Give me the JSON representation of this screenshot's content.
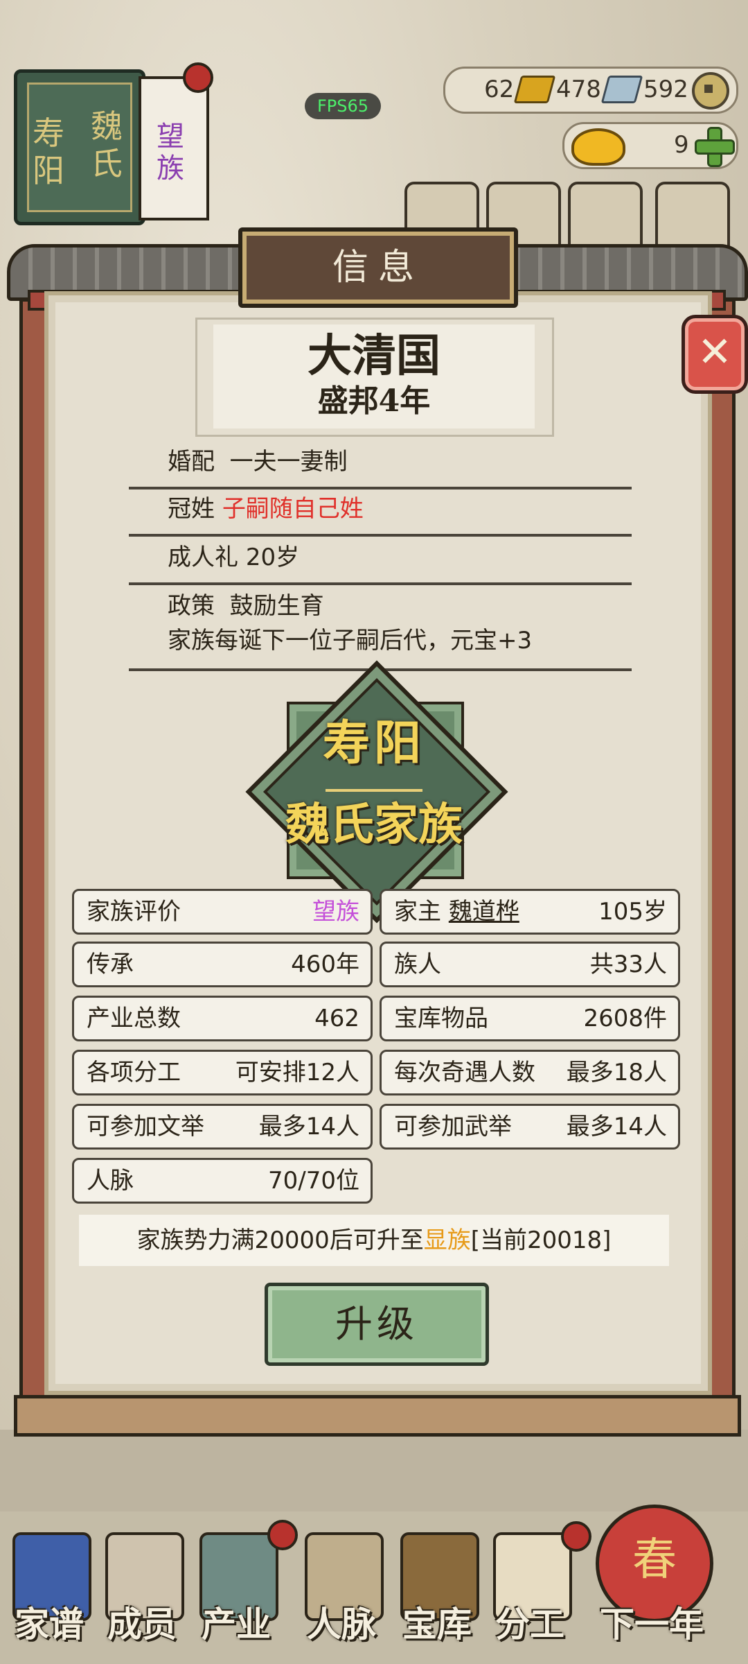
{
  "hud": {
    "fps": "FPS65",
    "gold": "62",
    "silver": "478",
    "coins": "592",
    "yuanbao": "9"
  },
  "family_book": {
    "place": "寿阳",
    "surname": "魏氏",
    "rank": "望族"
  },
  "dialog": {
    "title": "信息",
    "close_label": "✕",
    "nation": {
      "name": "大清国",
      "era": "盛邦4年"
    },
    "rules": {
      "marriage_label": "婚配",
      "marriage_value": "一夫一妻制",
      "surname_label": "冠姓",
      "surname_value": "子嗣随自己姓",
      "adult_label": "成人礼",
      "adult_value": "20岁",
      "policy_label": "政策",
      "policy_value": "鼓励生育",
      "policy_desc": "家族每诞下一位子嗣后代，元宝+3"
    },
    "emblem": {
      "line1": "寿阳",
      "line2": "魏氏家族"
    },
    "stats": {
      "rating_label": "家族评价",
      "rating_value": "望族",
      "head_label": "家主",
      "head_name": "魏道桦",
      "head_age": "105岁",
      "legacy_label": "传承",
      "legacy_value": "460年",
      "members_label": "族人",
      "members_value": "共33人",
      "industry_label": "产业总数",
      "industry_value": "462",
      "treasury_label": "宝库物品",
      "treasury_value": "2608件",
      "division_label": "各项分工",
      "division_value": "可安排12人",
      "encounter_label": "每次奇遇人数",
      "encounter_value": "最多18人",
      "civil_exam_label": "可参加文举",
      "civil_exam_value": "最多14人",
      "military_exam_label": "可参加武举",
      "military_exam_value": "最多14人",
      "network_label": "人脉",
      "network_value": "70/70位"
    },
    "upgrade": {
      "note_prefix": "家族势力满20000后可升至",
      "next_rank": "显族",
      "note_suffix": "[当前20018]",
      "button_label": "升级"
    }
  },
  "bottom_nav": {
    "items": [
      {
        "label": "家谱"
      },
      {
        "label": "成员"
      },
      {
        "label": "产业"
      },
      {
        "label": "人脉"
      },
      {
        "label": "宝库"
      },
      {
        "label": "分工"
      },
      {
        "label": "下一年"
      }
    ],
    "lantern_char": "春"
  },
  "colors": {
    "accent_red": "#e0302a",
    "rank_purple": "#c44fd9",
    "next_rank_orange": "#e79a18",
    "button_green": "#8fb58c",
    "panel_bg": "#e5dfd0"
  }
}
